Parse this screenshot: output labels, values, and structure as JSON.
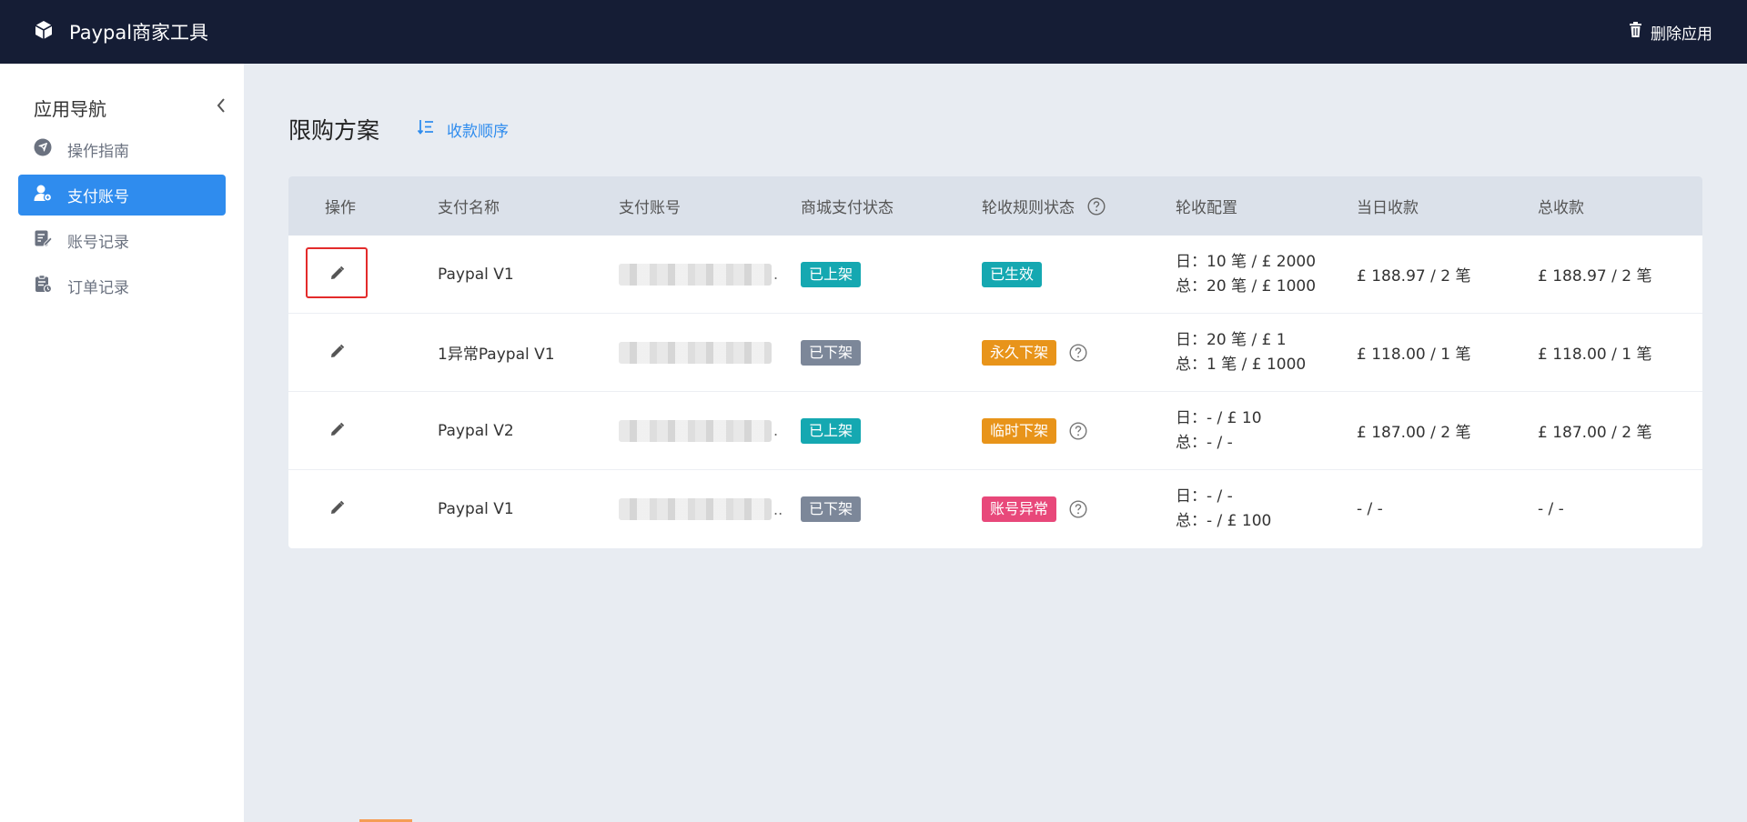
{
  "topbar": {
    "app_title": "Paypal商家工具",
    "brand_icon": "cube-icon",
    "delete_label": "删除应用",
    "delete_icon": "trash-icon"
  },
  "sidebar": {
    "title": "应用导航",
    "collapse_icon": "chevron-left-icon",
    "items": [
      {
        "label": "操作指南",
        "icon": "navigation-icon",
        "active": false
      },
      {
        "label": "支付账号",
        "icon": "user-icon",
        "active": true
      },
      {
        "label": "账号记录",
        "icon": "edit-document-icon",
        "active": false
      },
      {
        "label": "订单记录",
        "icon": "clipboard-icon",
        "active": false
      }
    ]
  },
  "main": {
    "page_title": "限购方案",
    "sort_link_label": "收款顺序",
    "table": {
      "headers": [
        "操作",
        "支付名称",
        "支付账号",
        "商城支付状态",
        "轮收规则状态",
        "轮收配置",
        "当日收款",
        "总收款"
      ],
      "rows": [
        {
          "name": "Paypal V1",
          "account_tail": ".",
          "mall_status": "已上架",
          "rule_status": "已生效",
          "config_day": "日：10 笔 / £ 2000",
          "config_total": "总：20 笔 / £ 1000",
          "today": "£ 188.97 / 2 笔",
          "total": "£ 188.97 / 2 笔"
        },
        {
          "name": "1异常Paypal V1",
          "account_tail": "",
          "mall_status": "已下架",
          "rule_status": "永久下架",
          "config_day": "日：20 笔 / £ 1",
          "config_total": "总：1 笔 / £ 1000",
          "today": "£ 118.00 / 1 笔",
          "total": "£ 118.00 / 1 笔"
        },
        {
          "name": "Paypal V2",
          "account_tail": ".",
          "mall_status": "已上架",
          "rule_status": "临时下架",
          "config_day": "日：- / £ 10",
          "config_total": "总：- / -",
          "today": "£ 187.00 / 2 笔",
          "total": "£ 187.00 / 2 笔"
        },
        {
          "name": "Paypal V1",
          "account_tail": "..",
          "mall_status": "已下架",
          "rule_status": "账号异常",
          "config_day": "日：- / -",
          "config_total": "总：- / £ 100",
          "today": "- / -",
          "total": "- / -"
        }
      ]
    }
  },
  "colors": {
    "topbar": "#151d35",
    "accent": "#2f8cee",
    "tag_teal": "#15a8b1",
    "tag_gray": "#7c8799",
    "tag_orange": "#e8941a",
    "tag_pink": "#e8487a",
    "highlight": "#e32b2b"
  }
}
